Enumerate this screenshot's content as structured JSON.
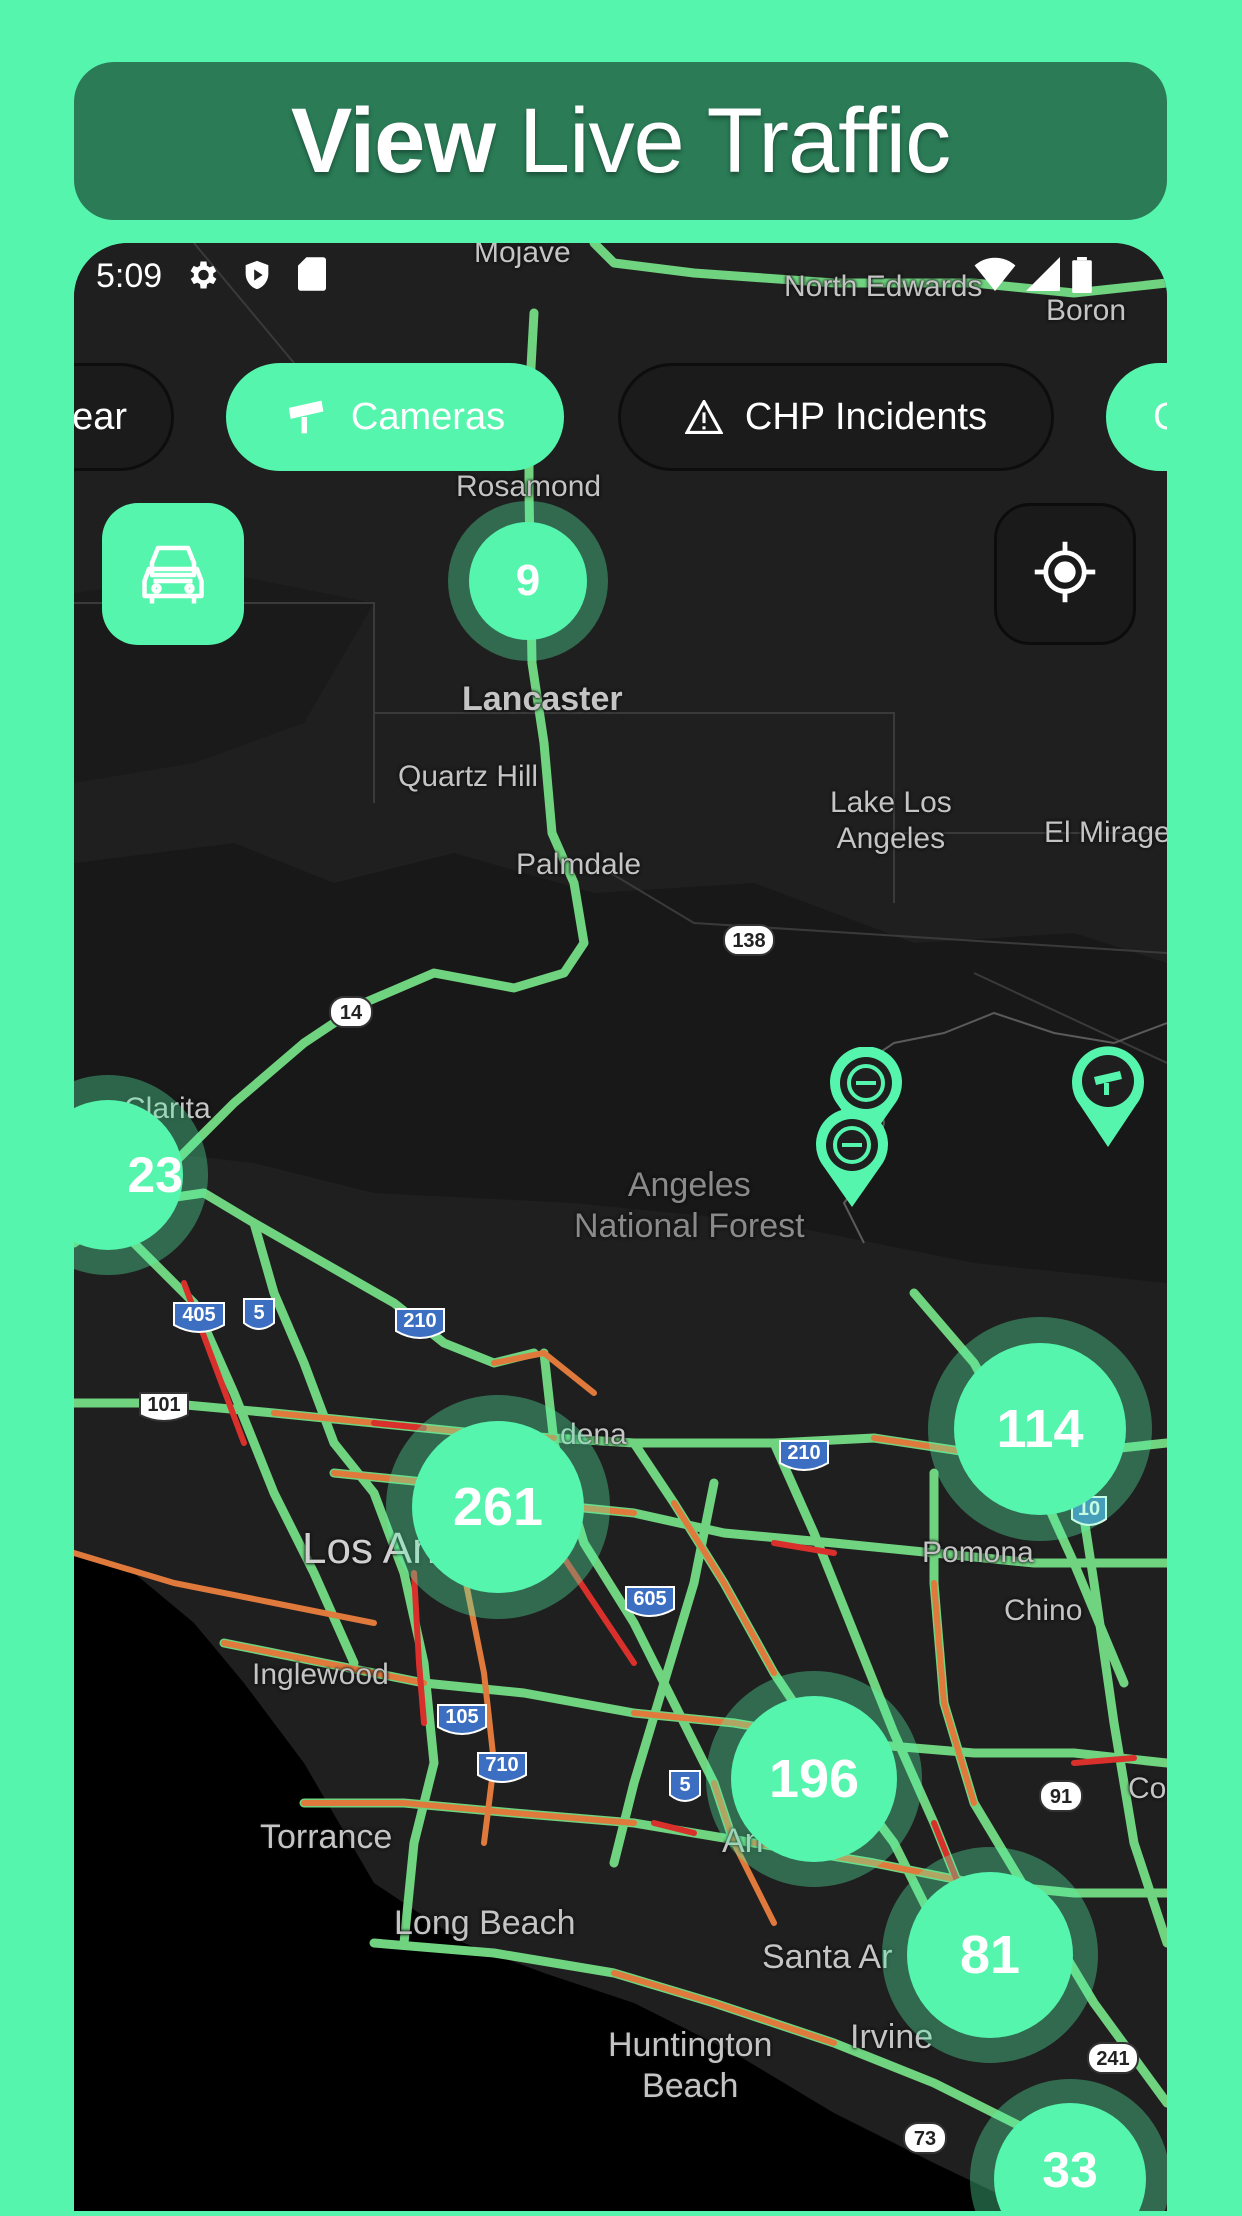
{
  "banner": {
    "bold": "View",
    "light": "Live Traffic"
  },
  "status": {
    "time": "5:09"
  },
  "chips": [
    {
      "label": "ear",
      "active": false
    },
    {
      "label": "Cameras",
      "active": true,
      "icon": "camera-icon"
    },
    {
      "label": "CHP Incidents",
      "active": false,
      "icon": "warning-icon"
    },
    {
      "label": "C",
      "active": true
    }
  ],
  "clusters": {
    "c9": "9",
    "c23": "23",
    "c261": "261",
    "c114": "114",
    "c196": "196",
    "c81": "81",
    "c33": "33"
  },
  "places": {
    "mojave": "Mojave",
    "north_edwards": "North Edwards",
    "boron": "Boron",
    "rosamond": "Rosamond",
    "lancaster": "Lancaster",
    "quartz_hill": "Quartz Hill",
    "palmdale": "Palmdale",
    "lake_los_angeles": "Lake Los\nAngeles",
    "el_mirage": "El Mirage",
    "clarita": "Clarita",
    "angeles_nf": "Angeles\nNational Forest",
    "pasadena": "dena",
    "los_angeles": "Los Angeles",
    "pomona": "Pomona",
    "chino": "Chino",
    "inglewood": "Inglewood",
    "torrance": "Torrance",
    "long_beach": "Long Beach",
    "santa_ana": "Santa Ar",
    "irvine": "Irvine",
    "huntington_beach": "Huntington\nBeach",
    "anaheim": "An",
    "corona": "Co"
  },
  "shields": {
    "s138": "138",
    "s14": "14",
    "s405": "405",
    "s5a": "5",
    "s210a": "210",
    "s101": "101",
    "s210b": "210",
    "s10": "10",
    "s605": "605",
    "s105": "105",
    "s710": "710",
    "s5b": "5",
    "s91": "91",
    "s241": "241",
    "s73": "73"
  },
  "colors": {
    "accent": "#55f5ad",
    "banner": "#2a7b56",
    "map": "#1f1f1f",
    "ocean": "#000000"
  }
}
